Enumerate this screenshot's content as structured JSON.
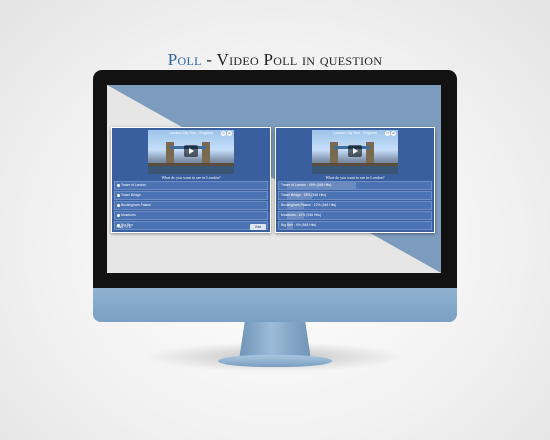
{
  "headline": {
    "brand": "Poll",
    "separator": " - ",
    "rest": "Video Poll in question"
  },
  "poll": {
    "video_title": "London City Tour - England",
    "question": "What do you want to see in London?",
    "options": [
      "Tower of London",
      "Tower Bridge",
      "Buckingham Palace",
      "Museums",
      "Big Ben"
    ],
    "total_label": "Total : 2.5",
    "vote_label": "Vote"
  },
  "results": {
    "video_title": "London City Tour - England",
    "question": "What do you want to see in London?",
    "rows": [
      {
        "label": "Tower of London : 49% (548 Hits)",
        "percent": 49
      },
      {
        "label": "Tower Bridge : 18% (548 Hits)",
        "percent": 18
      },
      {
        "label": "Buckingham Palace : 12% (548 Hits)",
        "percent": 12
      },
      {
        "label": "Museums : 12% (548 Hits)",
        "percent": 12
      },
      {
        "label": "Big Ben : 4% (548 Hits)",
        "percent": 4
      }
    ]
  },
  "colors": {
    "accent": "#2b62a6",
    "panel": "#3a5f9f",
    "monitor_body": "#7aa0c2"
  },
  "icons": [
    "clock-icon",
    "share-icon",
    "play-icon",
    "radio-icon"
  ]
}
